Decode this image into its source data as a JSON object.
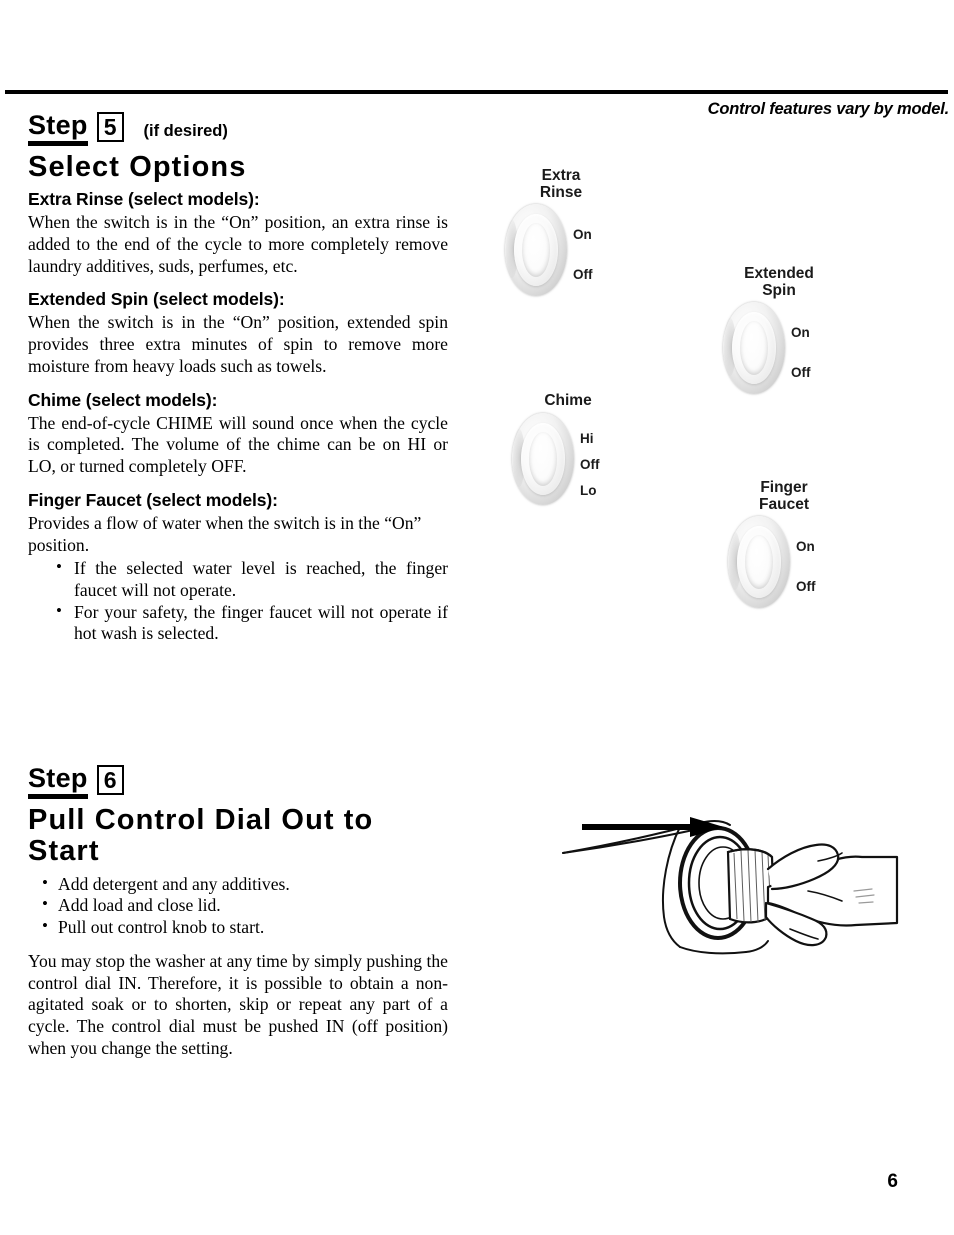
{
  "header": {
    "note": "Control features vary by model."
  },
  "step5": {
    "step_word": "Step",
    "number": "5",
    "suffix": "(if desired)",
    "title": "Select Options",
    "sections": [
      {
        "heading": "Extra Rinse (select models):",
        "body": "When the switch is in the “On” position, an extra rinse is added to the end of the cycle to more completely remove laundry additives, suds, perfumes, etc."
      },
      {
        "heading": "Extended Spin (select models):",
        "body": "When the switch is in the “On” position, extended spin provides three extra minutes of spin to remove more moisture from heavy loads such as towels."
      },
      {
        "heading": "Chime (select models):",
        "body": "The end-of-cycle CHIME will sound once when the cycle is completed. The volume of the chime can be on HI or LO, or turned completely OFF."
      },
      {
        "heading": "Finger Faucet (select models):",
        "body": "Provides a flow of water when the switch is in the “On” position.",
        "bullets": [
          "If the selected water level is reached, the finger faucet will not operate.",
          "For your safety, the finger faucet will not operate if hot wash is selected."
        ]
      }
    ]
  },
  "step6": {
    "step_word": "Step",
    "number": "6",
    "title": "Pull Control Dial Out to Start",
    "bullets": [
      "Add detergent and any additives.",
      "Add load and close lid.",
      "Pull out control knob to start."
    ],
    "body": "You may stop the washer at any time by simply pushing the control dial IN. Therefore, it is possible to obtain a non-agitated soak or to shorten, skip or repeat any part of a cycle. The control dial must be pushed IN (off position) when you change the setting."
  },
  "switches": [
    {
      "caption": "Extra\nRinse",
      "positions": [
        "On",
        "Off"
      ]
    },
    {
      "caption": "Extended\nSpin",
      "positions": [
        "On",
        "Off"
      ]
    },
    {
      "caption": "Chime",
      "positions": [
        "Hi",
        "Off",
        "Lo"
      ]
    },
    {
      "caption": "Finger\nFaucet",
      "positions": [
        "On",
        "Off"
      ]
    }
  ],
  "footer": {
    "page_number": "6"
  }
}
